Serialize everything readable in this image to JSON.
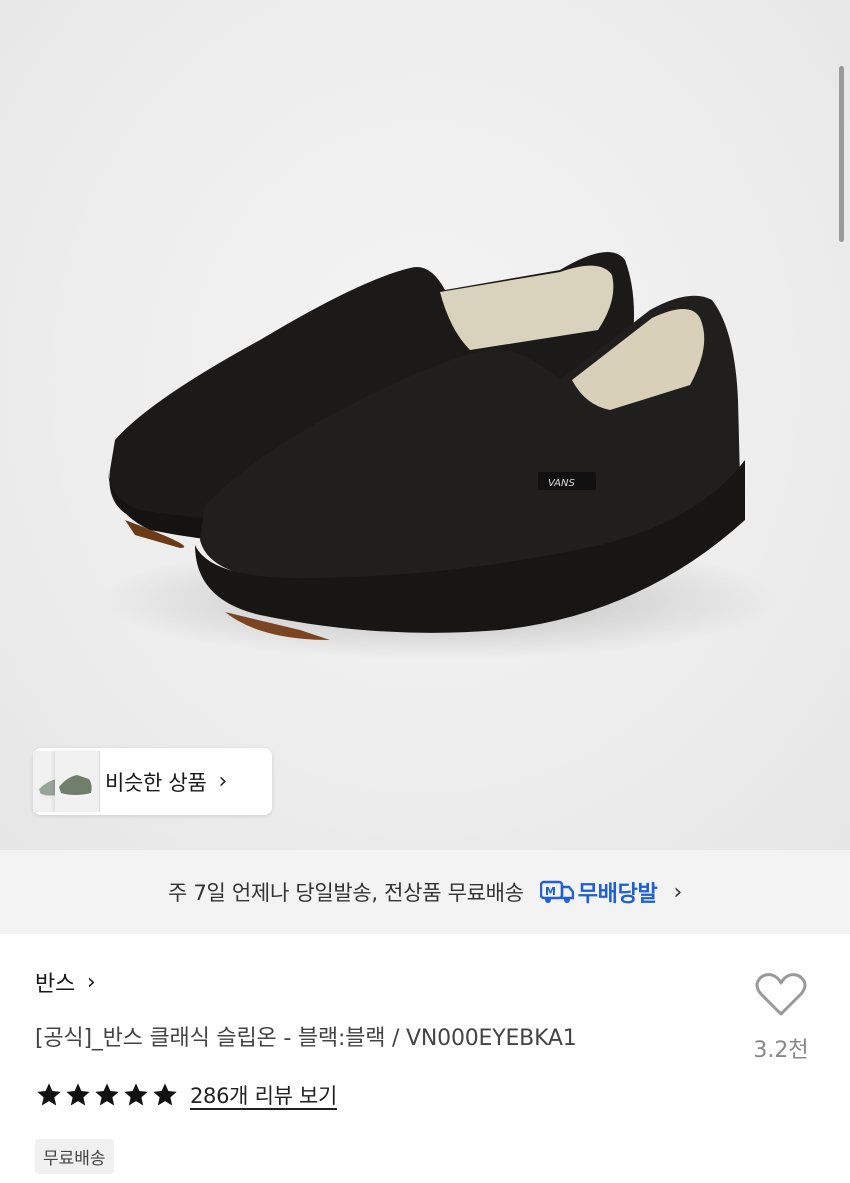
{
  "similar": {
    "label": "비슷한 상품"
  },
  "promo": {
    "text": "주 7일 언제나 당일발송, 전상품 무료배송",
    "logo_text": "무배당발",
    "logo_badge": "M",
    "accent": "#1f5fd6"
  },
  "product": {
    "brand": "반스",
    "title": "[공식]_반스 클래식 슬립온 - 블랙:블랙 / VN000EYEBKA1",
    "likes": "3.2천",
    "rating": 5,
    "review_link": "286개 리뷰 보기",
    "badge": "무료배송"
  },
  "hero": {
    "logo_text": "VANS"
  },
  "icons": {
    "similar_chevron": "chevron-right-icon",
    "promo_chevron": "chevron-right-icon",
    "brand_chevron": "chevron-right-icon",
    "like": "heart-outline-icon",
    "star": "star-filled-icon",
    "delivery": "truck-icon"
  },
  "glyphs": {
    "chevron": "›"
  }
}
